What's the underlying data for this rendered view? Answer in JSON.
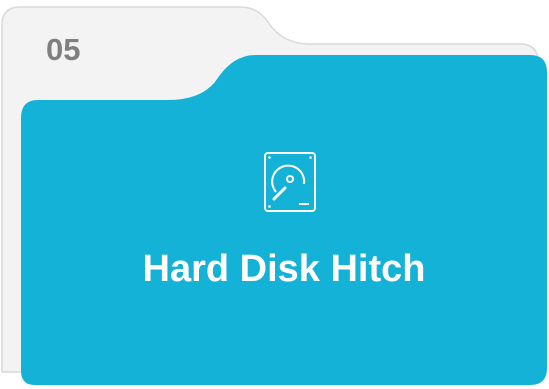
{
  "card": {
    "number": "05",
    "title": "Hard Disk Hitch",
    "icon": "hard-disk-icon"
  },
  "colors": {
    "accent": "#14b2d6",
    "tab_fill": "#f3f3f3",
    "tab_border": "#d9d9d9",
    "number_text": "#7f7f7f",
    "title_text": "#ffffff"
  }
}
